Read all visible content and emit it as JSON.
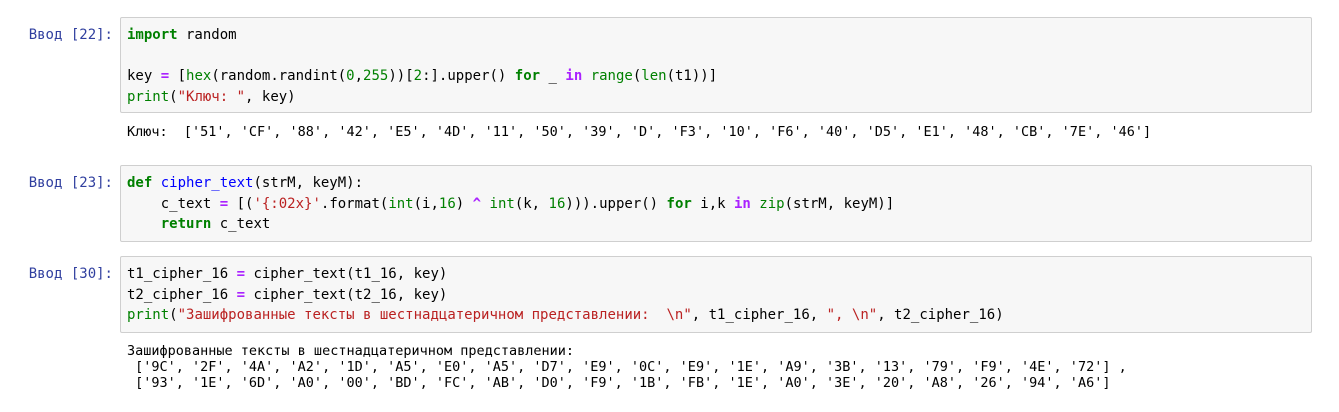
{
  "cells": [
    {
      "prompt": "Ввод [22]:",
      "code": {
        "l1_kw": "import",
        "l1_rest": " random",
        "l3_a": "key ",
        "l3_eq": "=",
        "l3_b": " [",
        "l3_hex": "hex",
        "l3_c": "(random.randint(",
        "l3_n0": "0",
        "l3_comma": ",",
        "l3_n255": "255",
        "l3_d": "))[",
        "l3_n2": "2",
        "l3_e": ":].upper() ",
        "l3_for": "for",
        "l3_f": " _ ",
        "l3_in": "in",
        "l3_g": " ",
        "l3_range": "range",
        "l3_h": "(",
        "l3_len": "len",
        "l3_i": "(t1))]",
        "l4_print": "print",
        "l4_a": "(",
        "l4_str": "\"Ключ: \"",
        "l4_b": ", key)"
      },
      "output": [
        "Ключ:  ['51', 'CF', '88', '42', 'E5', '4D', '11', '50', '39', 'D', 'F3', '10', 'F6', '40', 'D5', 'E1', '48', 'CB', '7E', '46']"
      ]
    },
    {
      "prompt": "Ввод [23]:",
      "code": {
        "l1_def": "def",
        "l1_sp": " ",
        "l1_name": "cipher_text",
        "l1_rest": "(strM, keyM):",
        "l2_a": "    c_text ",
        "l2_eq": "=",
        "l2_b": " [(",
        "l2_str": "'{:02x}'",
        "l2_c": ".format(",
        "l2_int1": "int",
        "l2_d": "(i,",
        "l2_n16a": "16",
        "l2_e": ") ",
        "l2_xor": "^",
        "l2_f": " ",
        "l2_int2": "int",
        "l2_g": "(k, ",
        "l2_n16b": "16",
        "l2_h": "))).upper() ",
        "l2_for": "for",
        "l2_i": " i,k ",
        "l2_in": "in",
        "l2_j": " ",
        "l2_zip": "zip",
        "l2_k": "(strM, keyM)]",
        "l3_ind": "    ",
        "l3_return": "return",
        "l3_rest": " c_text"
      }
    },
    {
      "prompt": "Ввод [30]:",
      "code": {
        "l1_a": "t1_cipher_16 ",
        "l1_eq": "=",
        "l1_b": " cipher_text(t1_16, key)",
        "l2_a": "t2_cipher_16 ",
        "l2_eq": "=",
        "l2_b": " cipher_text(t2_16, key)",
        "l3_print": "print",
        "l3_a": "(",
        "l3_str1": "\"Зашифрованные тексты в шестнадцатеричном представлении:  \\n\"",
        "l3_b": ", t1_cipher_16, ",
        "l3_str2": "\", \\n\"",
        "l3_c": ", t2_cipher_16)"
      },
      "output": [
        "Зашифрованные тексты в шестнадцатеричном представлении:",
        " ['9C', '2F', '4A', 'A2', '1D', 'A5', 'E0', 'A5', 'D7', 'E9', '0C', 'E9', '1E', 'A9', '3B', '13', '79', 'F9', '4E', '72'] ,",
        " ['93', '1E', '6D', 'A0', '00', 'BD', 'FC', 'AB', 'D0', 'F9', '1B', 'FB', '1E', 'A0', '3E', '20', 'A8', '26', '94', 'A6']"
      ]
    }
  ]
}
